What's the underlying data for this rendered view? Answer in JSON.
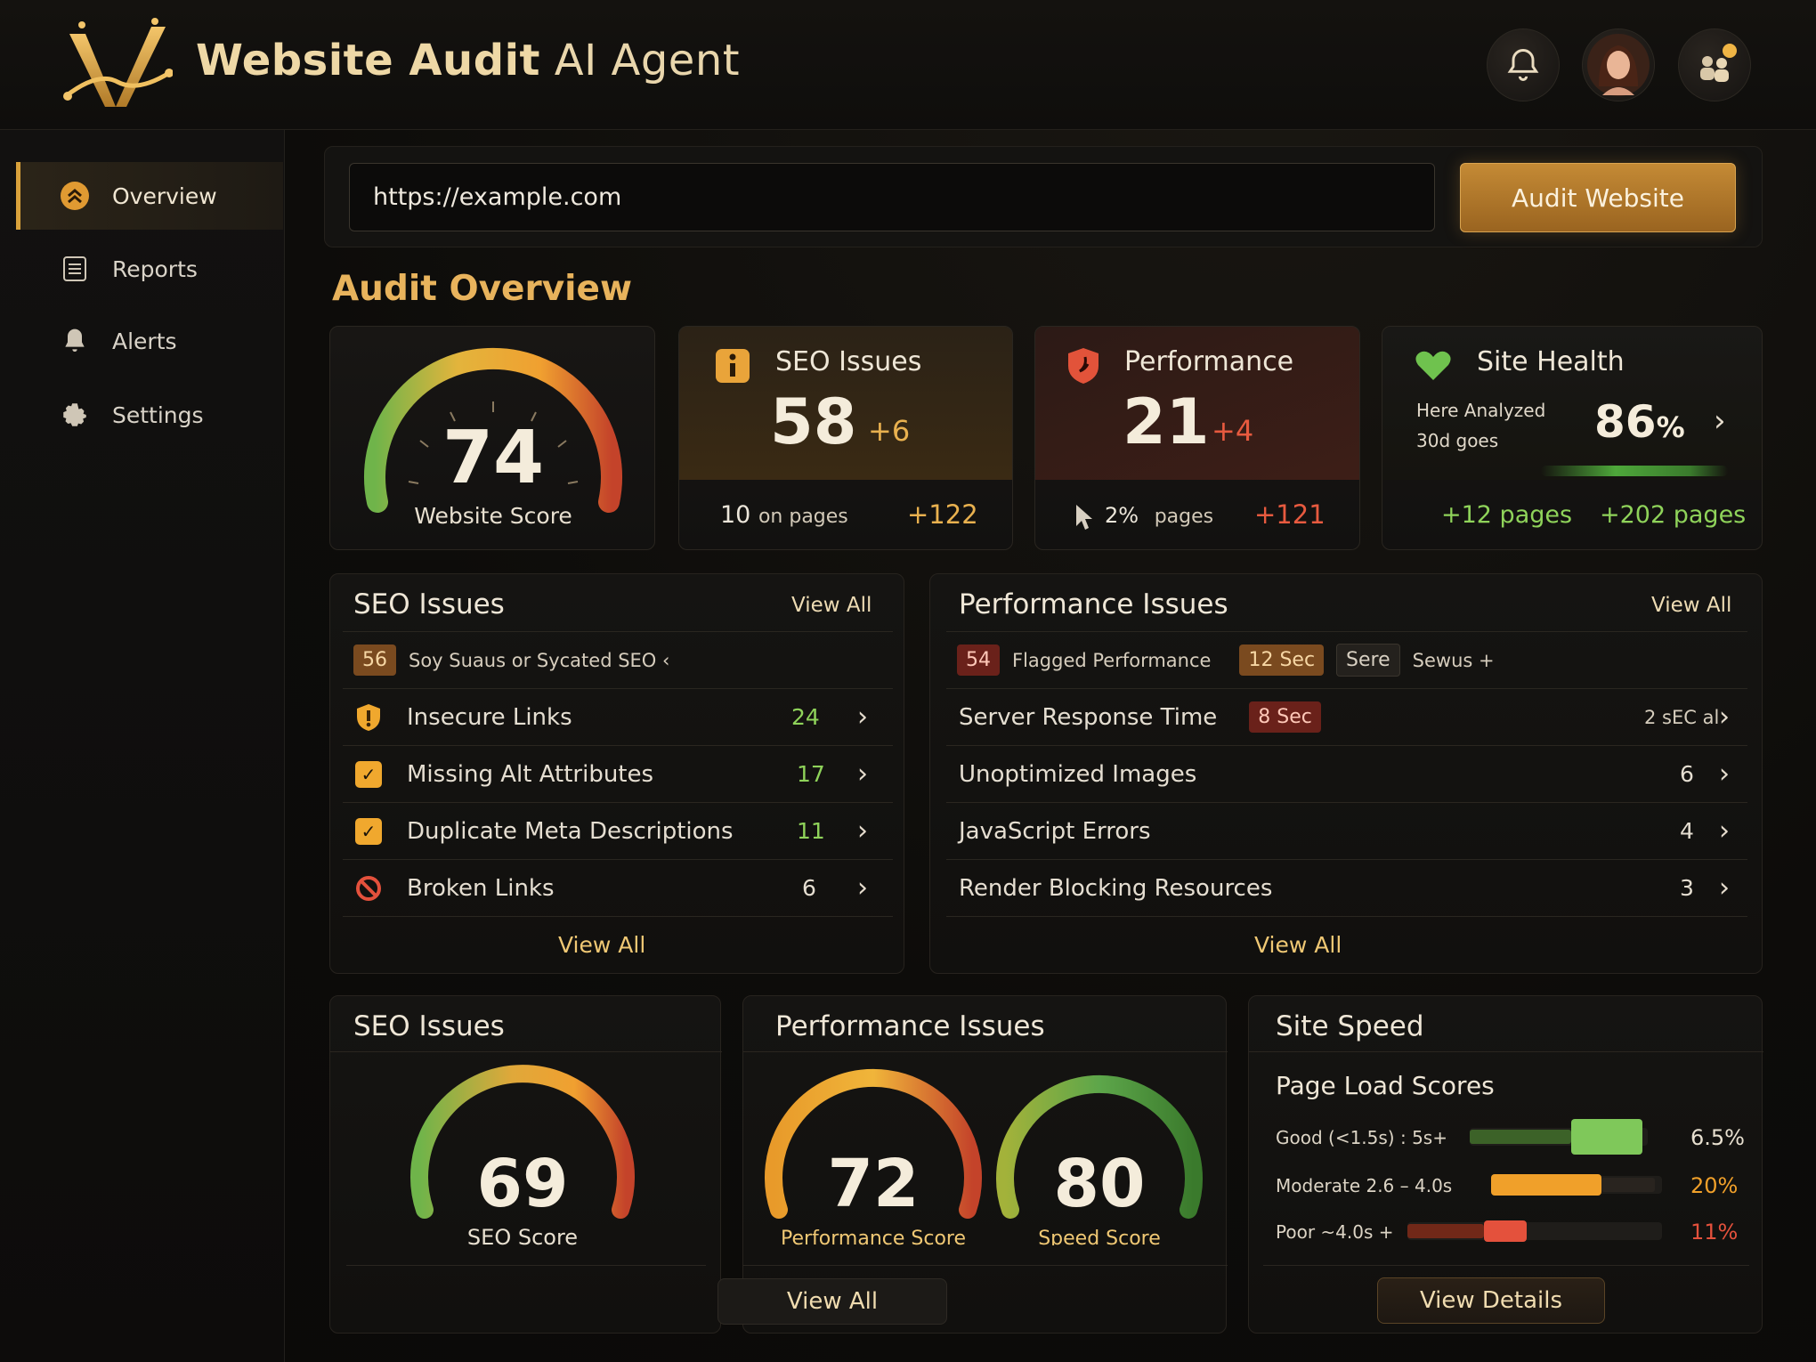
{
  "app": {
    "title_bold": "Website Audit",
    "title_light": " AI Agent"
  },
  "header": {
    "icons": [
      "bell-icon",
      "avatar",
      "users-icon"
    ]
  },
  "sidebar": {
    "items": [
      {
        "label": "Overview",
        "icon": "chevron-up-circle-icon",
        "active": true
      },
      {
        "label": "Reports",
        "icon": "document-icon"
      },
      {
        "label": "Alerts",
        "icon": "bell-icon"
      },
      {
        "label": "Settings",
        "icon": "gear-icon"
      }
    ]
  },
  "url_bar": {
    "value": "https://example.com",
    "button": "Audit Website"
  },
  "overview": {
    "title": "Audit Overview",
    "website_score": {
      "value": "74",
      "label": "Website Score",
      "level": 0.74
    },
    "seo": {
      "title": "SEO Issues",
      "value": "58",
      "delta": "+6",
      "sub_count": "10",
      "sub_label": "on pages",
      "sub_delta": "+122"
    },
    "performance": {
      "title": "Performance",
      "value": "21",
      "delta": "+4",
      "sub_count": "2%",
      "sub_label": "pages",
      "sub_delta": "+121"
    },
    "health": {
      "title": "Site Health",
      "line1": "Here Analyzed",
      "line2": "30d goes",
      "value": "86",
      "unit": "%",
      "left": "+12 pages",
      "right": "+202 pages"
    }
  },
  "seo_issues": {
    "title": "SEO Issues",
    "view_all": "View All",
    "footer": "View All",
    "summary": {
      "badge": "56",
      "text": "Soy Suaus or Sycated SEO ‹"
    },
    "rows": [
      {
        "label": "Insecure Links",
        "count": "24",
        "icon": "shield-icon"
      },
      {
        "label": "Missing Alt Attributes",
        "count": "17",
        "icon": "checkbox-icon"
      },
      {
        "label": "Duplicate Meta Descriptions",
        "count": "11",
        "icon": "checkbox-icon"
      },
      {
        "label": "Broken Links",
        "count": "6",
        "icon": "broken-link-icon"
      }
    ]
  },
  "perf_issues": {
    "title": "Performance Issues",
    "view_all": "View All",
    "footer": "View All",
    "summary": {
      "badge": "54",
      "text": "Flagged Performance",
      "tag1": "12 Sec",
      "tag2": "Sere",
      "tag3": "Sewus +"
    },
    "rows": [
      {
        "label": "Server Response Time",
        "tag": "8 Sec",
        "value": "2 sEC al"
      },
      {
        "label": "Unoptimized Images",
        "value": "6"
      },
      {
        "label": "JavaScript Errors",
        "value": "4"
      },
      {
        "label": "Render Blocking Resources",
        "value": "3"
      }
    ]
  },
  "bottom": {
    "seo": {
      "title": "SEO Issues",
      "value": "69",
      "label": "SEO Score"
    },
    "perf": {
      "title": "Performance Issues",
      "value": "72",
      "label": "Performance Score",
      "value2": "80",
      "label2": "Speed Score",
      "view_all": "View All"
    },
    "speed": {
      "title": "Site Speed",
      "subtitle": "Page Load Scores",
      "button": "View Details",
      "bars": [
        {
          "label": "Good (<1.5s) : 5s+",
          "pct": "6.5%",
          "color": "#7fc85a"
        },
        {
          "label": "Moderate 2.6 – 4.0s",
          "pct": "20%",
          "color": "#f0a02a"
        },
        {
          "label": "Poor  ~4.0s +",
          "pct": "11%",
          "color": "#e4513c"
        }
      ]
    }
  },
  "colors": {
    "accent": "#d9a23b",
    "good": "#7fc85a",
    "bad": "#e4513c"
  }
}
